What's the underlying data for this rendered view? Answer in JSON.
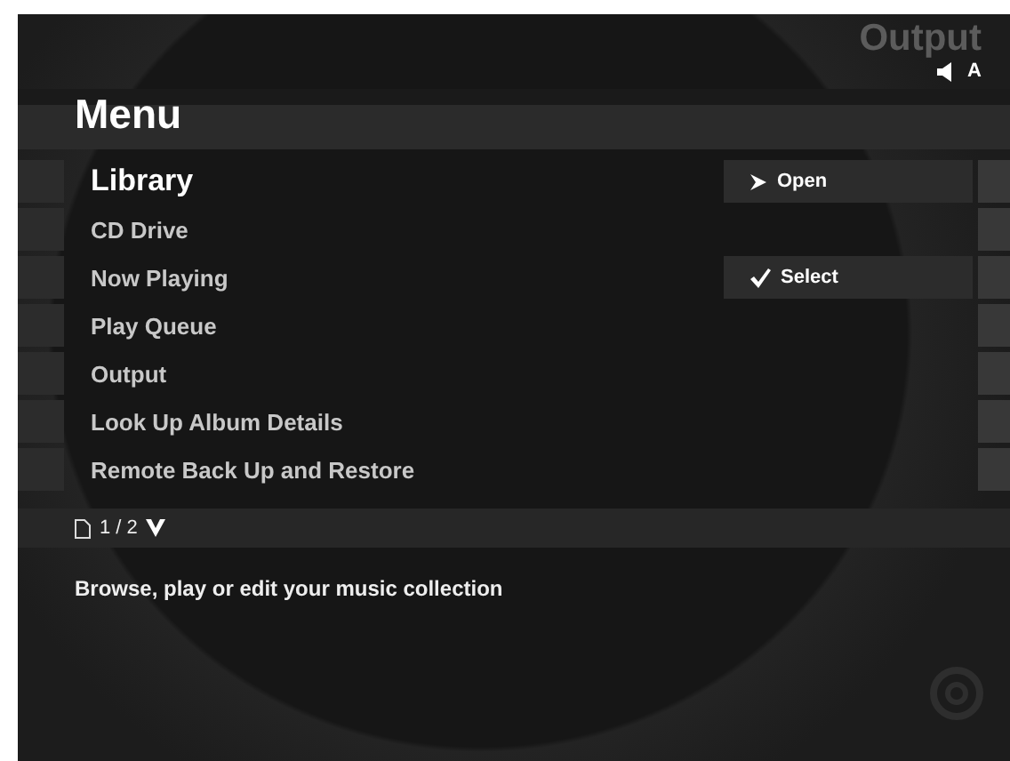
{
  "header": {
    "context": "Output",
    "speaker_label": "A"
  },
  "title": "Menu",
  "items": [
    {
      "label": "Library",
      "selected": true,
      "action": {
        "kind": "open",
        "label": "Open"
      }
    },
    {
      "label": "CD Drive",
      "selected": false
    },
    {
      "label": "Now Playing",
      "selected": false,
      "action": {
        "kind": "select",
        "label": "Select"
      }
    },
    {
      "label": "Play Queue",
      "selected": false
    },
    {
      "label": "Output",
      "selected": false
    },
    {
      "label": "Look Up Album Details",
      "selected": false
    },
    {
      "label": "Remote Back Up and Restore",
      "selected": false
    }
  ],
  "pager": {
    "text": "1 / 2"
  },
  "description": "Browse, play or edit your music collection"
}
